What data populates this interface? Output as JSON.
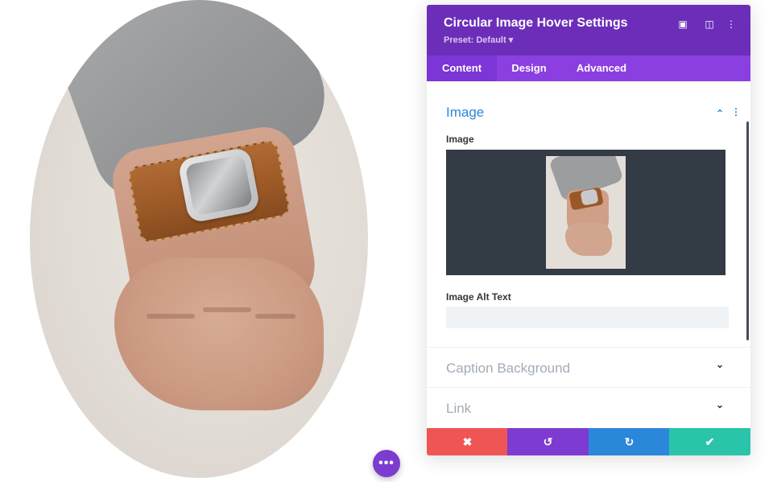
{
  "panel": {
    "title": "Circular Image Hover Settings",
    "preset": "Preset: Default ▾",
    "header_icons": [
      "expand-icon",
      "split-view-icon",
      "more-vertical-icon"
    ],
    "header_icon_glyphs": [
      "▣",
      "◫",
      "⋮"
    ],
    "tabs": [
      {
        "label": "Content",
        "active": true
      },
      {
        "label": "Design",
        "active": false
      },
      {
        "label": "Advanced",
        "active": false
      }
    ],
    "sections": {
      "image": {
        "title": "Image",
        "collapse_glyph": "⌃",
        "menu_glyph": "⋮",
        "image_label": "Image",
        "alt_label": "Image Alt Text",
        "alt_value": ""
      },
      "caption_background": {
        "title": "Caption Background",
        "chevron_glyph": "⌄"
      },
      "link": {
        "title": "Link",
        "chevron_glyph": "⌄"
      }
    },
    "footer": [
      {
        "name": "discard",
        "glyph": "✖",
        "color": "#ef5555"
      },
      {
        "name": "undo",
        "glyph": "↺",
        "color": "#7d3bd1"
      },
      {
        "name": "redo",
        "glyph": "↻",
        "color": "#2b87da"
      },
      {
        "name": "save",
        "glyph": "✔",
        "color": "#29c4a9"
      }
    ]
  },
  "fab": {
    "glyph": "•••",
    "color": "#7d3bd1"
  },
  "colors": {
    "header_purple": "#6c2eb9",
    "tab_purple": "#8b3fe0",
    "accent_blue": "#2b87da",
    "muted_section": "#a3acb8"
  }
}
